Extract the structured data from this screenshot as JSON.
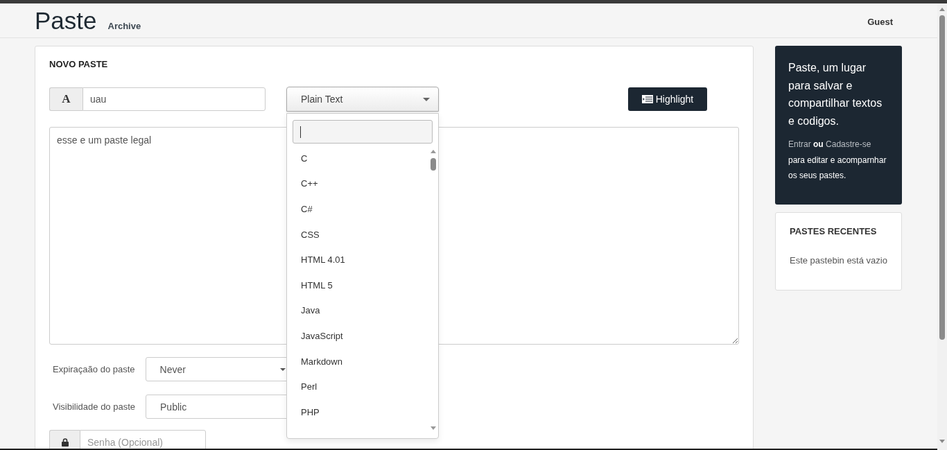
{
  "header": {
    "logo": "Paste",
    "nav_link": "Archive",
    "user": "Guest"
  },
  "paste_form": {
    "title": "NOVO PASTE",
    "title_input": {
      "addon": "A",
      "value": "uau"
    },
    "language_select": {
      "value": "Plain Text",
      "expanded": true,
      "options": [
        {
          "label": "C",
          "selected": false
        },
        {
          "label": "C++",
          "selected": false
        },
        {
          "label": "C#",
          "selected": false
        },
        {
          "label": "CSS",
          "selected": false
        },
        {
          "label": "HTML 4.01",
          "selected": false
        },
        {
          "label": "HTML 5",
          "selected": false
        },
        {
          "label": "Java",
          "selected": false
        },
        {
          "label": "JavaScript",
          "selected": false
        },
        {
          "label": "Markdown",
          "selected": false
        },
        {
          "label": "Perl",
          "selected": false
        },
        {
          "label": "PHP",
          "selected": false
        }
      ]
    },
    "highlight_button": "Highlight",
    "content": "esse e um paste legal",
    "expiration": {
      "label": "Expiraçaão do paste",
      "value": "Never"
    },
    "visibility": {
      "label": "Visibilidade do paste",
      "value": "Public"
    },
    "password": {
      "placeholder": "Senha (Opcional)"
    }
  },
  "sidebar": {
    "intro": "Paste, um lugar para salvar e compartilhar textos e codigos.",
    "login_link": "Entrar",
    "separator": "ou",
    "signup_link": "Cadastre-se",
    "note": "para editar e acomparnhar os seus pastes.",
    "recent": {
      "title": "PASTES RECENTES",
      "empty_text": "Este pastebin está vazio"
    }
  }
}
